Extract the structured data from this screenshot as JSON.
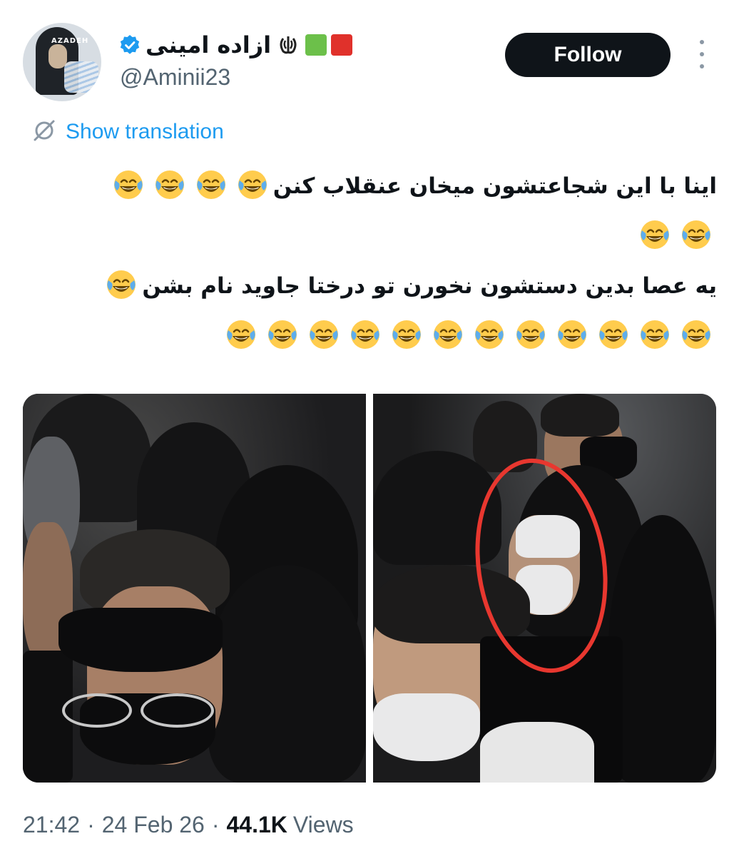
{
  "tweet": {
    "author": {
      "display_name": "ازاده امینی",
      "handle": "@Aminii23",
      "verified": true,
      "avatar_text": "AZADEH",
      "name_emojis": [
        "iran-emblem",
        "green-square",
        "red-square"
      ]
    },
    "follow_label": "Follow",
    "translation_label": "Show translation",
    "text_lines": [
      "اینا با این شجاعتشون میخان عنقلاب کنن",
      "یه عصا بدین دستشون نخورن تو درختا جاوید نام بشن"
    ],
    "emoji_name": "face-with-tears-of-joy",
    "emoji_counts": {
      "line1_tail": 4,
      "line2_full": 2,
      "line3_tail": 1,
      "line4_full": 12
    },
    "meta": {
      "time": "21:42",
      "date": "24 Feb 26",
      "views_count": "44.1K",
      "views_label": "Views"
    }
  },
  "colors": {
    "accent": "#1d9bf0",
    "follow_bg": "#0f1419",
    "secondary_text": "#536471",
    "annotation_red": "#e8372f",
    "green_square": "#6cc04a",
    "red_square": "#e0312b"
  }
}
